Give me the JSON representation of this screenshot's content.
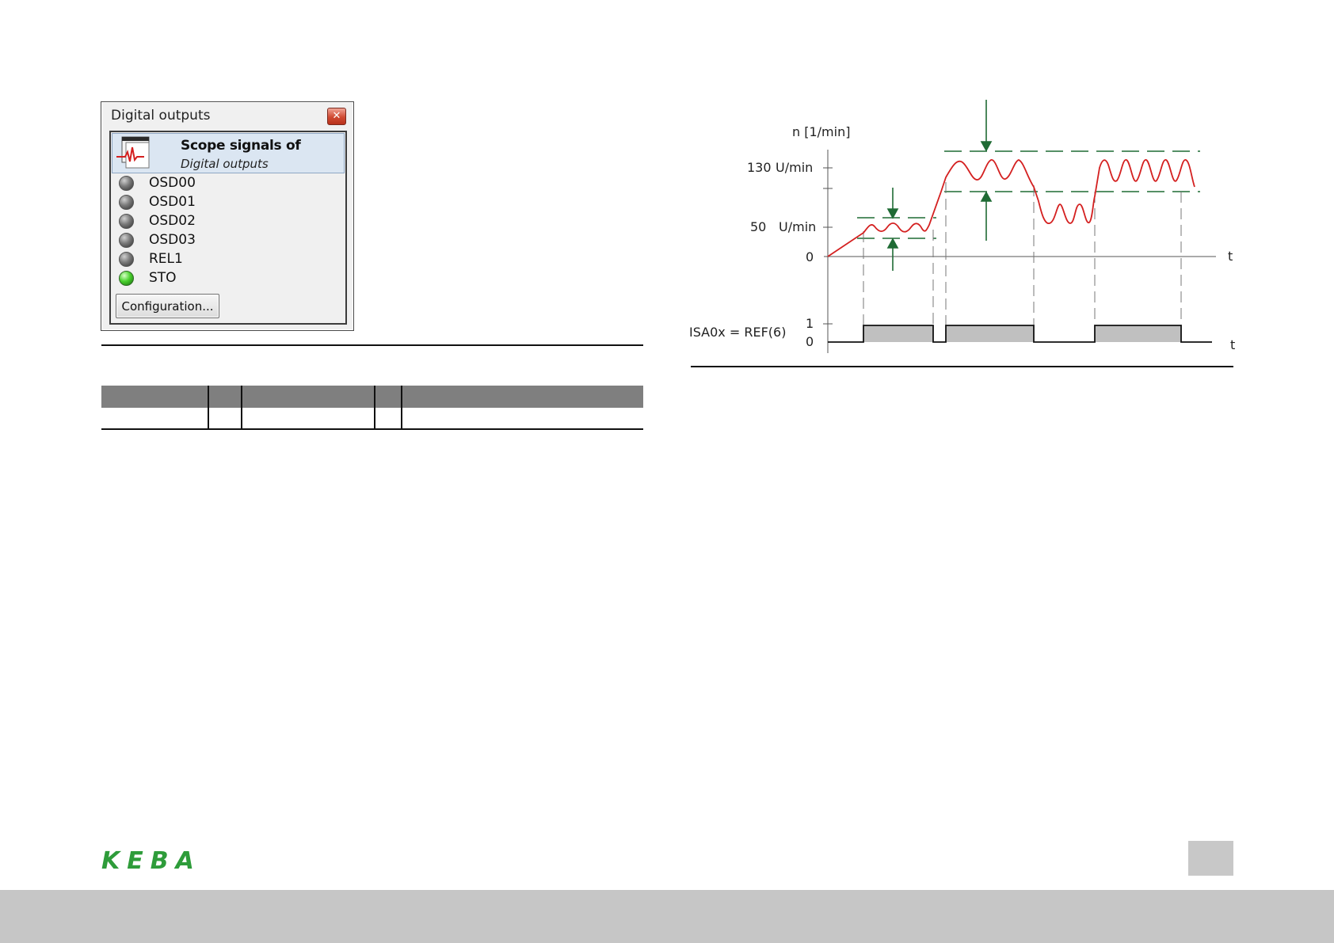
{
  "window": {
    "title": "Digital outputs",
    "close_label": "x",
    "scope": {
      "line1": "Scope signals of",
      "line2": "Digital outputs"
    },
    "outputs": [
      {
        "label": "OSD00",
        "state": "off"
      },
      {
        "label": "OSD01",
        "state": "off"
      },
      {
        "label": "OSD02",
        "state": "off"
      },
      {
        "label": "OSD03",
        "state": "off"
      },
      {
        "label": "REL1",
        "state": "off"
      },
      {
        "label": "STO",
        "state": "on"
      }
    ],
    "config_button_label": "Configuration..."
  },
  "colors": {
    "speed_curve": "#d42020",
    "window_lines": "#1f6b34",
    "signal_fill": "#c0c0c0",
    "led_on": "#4ad12e",
    "led_off": "#7a7a7a",
    "brand": "#2e9c3a",
    "footer": "#c6c6c6"
  },
  "chart_data": {
    "type": "line",
    "speed_axis_label": "n [1/min]",
    "speed_ticks": [
      {
        "value": "130",
        "unit": "U/min"
      },
      {
        "value": "50",
        "unit": "U/min"
      },
      {
        "value": "0",
        "unit": ""
      }
    ],
    "time_label": "t",
    "signal_label": "ISA0x = REF(6)",
    "signal_levels": [
      "1",
      "0"
    ],
    "signal_time_label": "t"
  },
  "footer": {
    "logo": "KEBA"
  }
}
